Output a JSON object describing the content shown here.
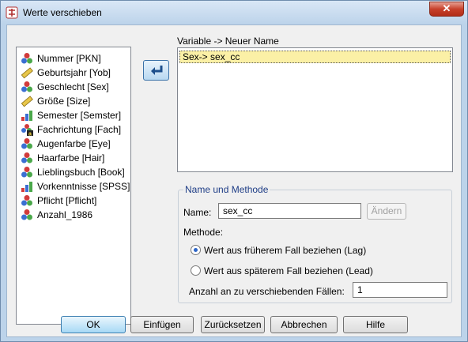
{
  "window": {
    "title": "Werte verschieben",
    "close_glyph": "✕"
  },
  "variables": [
    {
      "label": "Nummer [PKN]",
      "icon": "nominal-icon"
    },
    {
      "label": "Geburtsjahr [Yob]",
      "icon": "scale-icon"
    },
    {
      "label": "Geschlecht [Sex]",
      "icon": "nominal-icon"
    },
    {
      "label": "Größe [Size]",
      "icon": "scale-icon"
    },
    {
      "label": "Semester [Semster]",
      "icon": "ordinal-icon"
    },
    {
      "label": "Fachrichtung [Fach]",
      "icon": "string-nominal-icon"
    },
    {
      "label": "Augenfarbe [Eye]",
      "icon": "nominal-icon"
    },
    {
      "label": "Haarfarbe [Hair]",
      "icon": "nominal-icon"
    },
    {
      "label": "Lieblingsbuch [Book]",
      "icon": "nominal-icon"
    },
    {
      "label": "Vorkenntnisse [SPSS]",
      "icon": "ordinal-icon"
    },
    {
      "label": "Pflicht [Pflicht]",
      "icon": "nominal-icon"
    },
    {
      "label": "Anzahl_1986",
      "icon": "nominal-icon"
    }
  ],
  "mapping": {
    "header": "Variable -> Neuer Name",
    "entry": "Sex-> sex_cc"
  },
  "group": {
    "title": "Name und Methode",
    "name_label": "Name:",
    "name_value": "sex_cc",
    "change_button": "Ändern",
    "method_label": "Methode:",
    "lag_label": "Wert aus früherem Fall beziehen (Lag)",
    "lead_label": "Wert aus späterem Fall beziehen (Lead)",
    "selected_method": "lag",
    "count_label": "Anzahl an zu verschiebenden Fällen:",
    "count_value": "1"
  },
  "buttons": {
    "ok": "OK",
    "paste": "Einfügen",
    "reset": "Zurücksetzen",
    "cancel": "Abbrechen",
    "help": "Hilfe"
  },
  "colors": {
    "selection": "#fbf0a6",
    "group_title": "#1e3d86",
    "move_button": "#b8d8f1"
  }
}
